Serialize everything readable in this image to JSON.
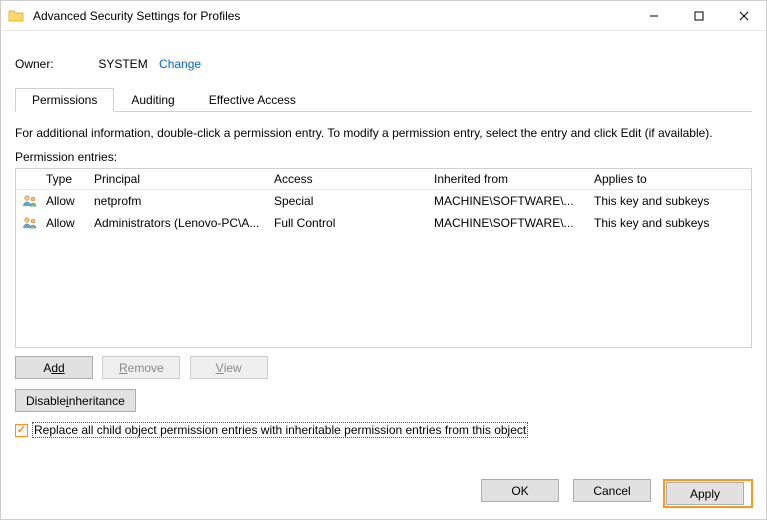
{
  "window": {
    "title": "Advanced Security Settings for Profiles"
  },
  "owner": {
    "label": "Owner:",
    "value": "SYSTEM",
    "change_link": "Change"
  },
  "tabs": {
    "permissions": "Permissions",
    "auditing": "Auditing",
    "effective": "Effective Access"
  },
  "hint": "For additional information, double-click a permission entry. To modify a permission entry, select the entry and click Edit (if available).",
  "entries_label": "Permission entries:",
  "columns": {
    "type": "Type",
    "principal": "Principal",
    "access": "Access",
    "inherited": "Inherited from",
    "applies": "Applies to"
  },
  "rows": [
    {
      "type": "Allow",
      "principal": "netprofm",
      "access": "Special",
      "inherited": "MACHINE\\SOFTWARE\\...",
      "applies": "This key and subkeys"
    },
    {
      "type": "Allow",
      "principal": "Administrators (Lenovo-PC\\A...",
      "access": "Full Control",
      "inherited": "MACHINE\\SOFTWARE\\...",
      "applies": "This key and subkeys"
    }
  ],
  "buttons": {
    "add": "Add",
    "remove": "Remove",
    "view": "View",
    "disable_inh": "Disable inheritance",
    "ok": "OK",
    "cancel": "Cancel",
    "apply": "Apply"
  },
  "checkbox": {
    "checked": true,
    "text": "Replace all child object permission entries with inheritable permission entries from this object"
  }
}
